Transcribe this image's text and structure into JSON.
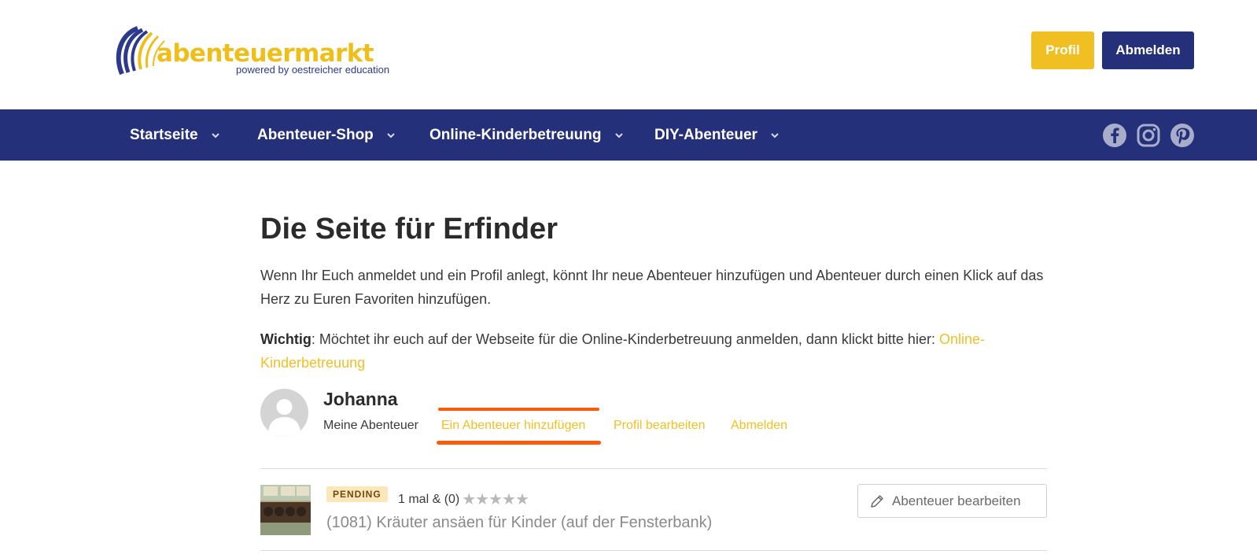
{
  "header": {
    "logo_text": "abenteuermarkt",
    "logo_tagline": "powered by oestreicher education",
    "profil_label": "Profil",
    "abmelden_label": "Abmelden"
  },
  "nav": {
    "items": [
      {
        "label": "Startseite"
      },
      {
        "label": "Abenteuer-Shop"
      },
      {
        "label": "Online-Kinderbetreuung"
      },
      {
        "label": "DIY-Abenteuer"
      }
    ],
    "social_icons": [
      "facebook-icon",
      "instagram-icon",
      "pinterest-icon"
    ]
  },
  "main": {
    "title": "Die Seite für Erfinder",
    "intro": "Wenn Ihr Euch anmeldet und ein Profil anlegt, könnt Ihr neue Abenteuer hinzufügen und Abenteuer durch einen Klick auf das Herz zu Euren Favoriten hinzufügen.",
    "notice_label": "Wichtig",
    "notice_text": ": Möchtet ihr euch auf der Webseite für die Online-Kinderbetreuung anmelden, dann klickt bitte hier: ",
    "notice_link": "Online-Kinderbetreuung"
  },
  "user": {
    "name": "Johanna",
    "links": {
      "meine": "Meine Abenteuer",
      "add": "Ein Abenteuer hinzufügen",
      "edit_profile": "Profil bearbeiten",
      "logout": "Abmelden"
    }
  },
  "entries": [
    {
      "status": "PENDING",
      "count": "1 mal & (0)",
      "stars": "★★★★★",
      "rating": 0,
      "title": "(1081) Kräuter ansäen für Kinder (auf der Fensterbank)",
      "edit_label": "Abenteuer bearbeiten"
    }
  ],
  "colors": {
    "brand_navy": "#25307a",
    "brand_gold": "#f0c023",
    "highlight": "#ff5a0a"
  }
}
